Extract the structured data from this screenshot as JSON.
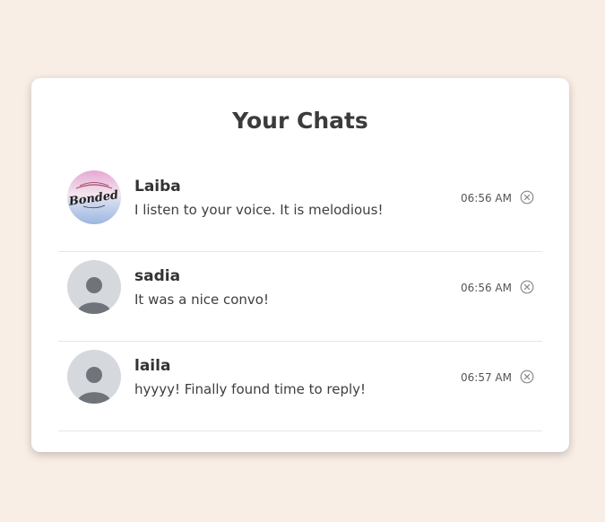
{
  "page": {
    "title": "Your Chats"
  },
  "chats": [
    {
      "name": "Laiba",
      "preview": "I listen to your voice. It is melodious!",
      "time": "06:56 AM",
      "avatar": "bonded-logo-image",
      "avatar_text": "Bonded"
    },
    {
      "name": "sadia",
      "preview": "It was a nice convo!",
      "time": "06:56 AM",
      "avatar": "default-user-icon"
    },
    {
      "name": "laila",
      "preview": "hyyyy! Finally found time to reply!",
      "time": "06:57 AM",
      "avatar": "default-user-icon"
    }
  ],
  "colors": {
    "background": "#f9eee5",
    "card": "#ffffff",
    "avatar_default_bg": "#d5d8dd",
    "avatar_default_fg": "#6f747a"
  }
}
